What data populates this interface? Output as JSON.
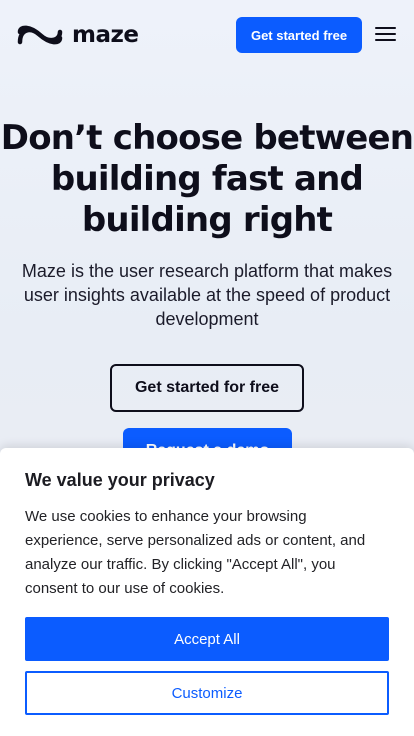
{
  "header": {
    "logo_text": "maze",
    "cta_label": "Get started free",
    "logo_icon": "maze-logo-icon",
    "menu_icon": "hamburger-menu-icon"
  },
  "hero": {
    "title": "Don’t choose between building fast and building right",
    "subtitle": "Maze is the user research platform that makes user insights available at the speed of product development",
    "primary_button": "Get started for free",
    "secondary_button": "Request a demo"
  },
  "cookie_banner": {
    "title": "We value your privacy",
    "text": "We use cookies to enhance your browsing experience, serve personalized ads or content, and analyze our traffic. By clicking \"Accept All\", you consent to our use of cookies.",
    "accept_label": "Accept All",
    "customize_label": "Customize"
  },
  "colors": {
    "accent": "#0b5cff",
    "text": "#0e0e1b",
    "background": "#eef2fa"
  }
}
